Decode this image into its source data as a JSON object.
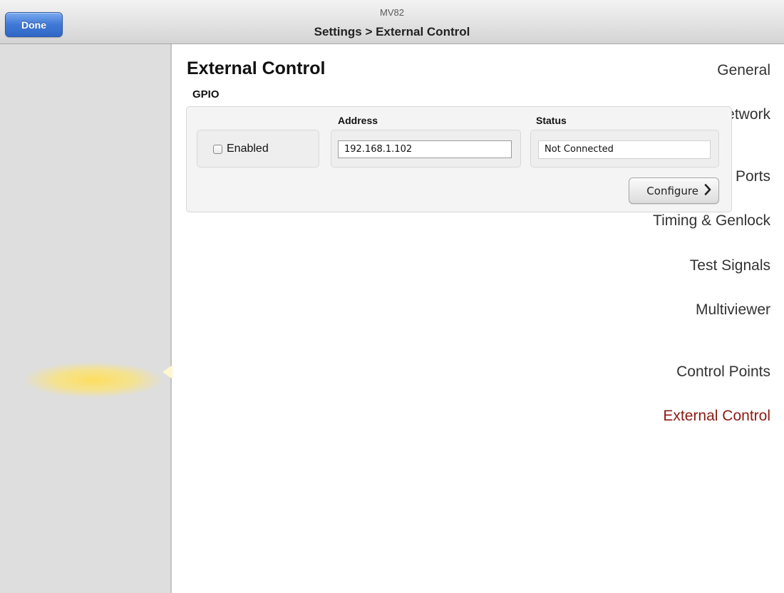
{
  "header": {
    "done_label": "Done",
    "device_name": "MV82",
    "breadcrumb": "Settings > External Control"
  },
  "sidebar": {
    "items": [
      {
        "label": "General"
      },
      {
        "label": "Network"
      },
      {
        "label": "Ports"
      },
      {
        "label": "Timing & Genlock"
      },
      {
        "label": "Test Signals"
      },
      {
        "label": "Multiviewer"
      },
      {
        "label": "Control Points"
      },
      {
        "label": "External Control",
        "active": true
      }
    ],
    "active_highlight_color": "#ffde5a",
    "active_text_color": "#8c1a12"
  },
  "main": {
    "title": "External Control",
    "section": "GPIO",
    "columns": {
      "address": "Address",
      "status": "Status"
    },
    "enabled": {
      "label": "Enabled",
      "checked": false
    },
    "address_value": "192.168.1.102",
    "status_value": "Not Connected",
    "configure_label": "Configure",
    "configure_icon": "chevron-right-icon"
  },
  "colors": {
    "done_button": "#3f78d6",
    "sidebar_bg": "#dedede"
  }
}
